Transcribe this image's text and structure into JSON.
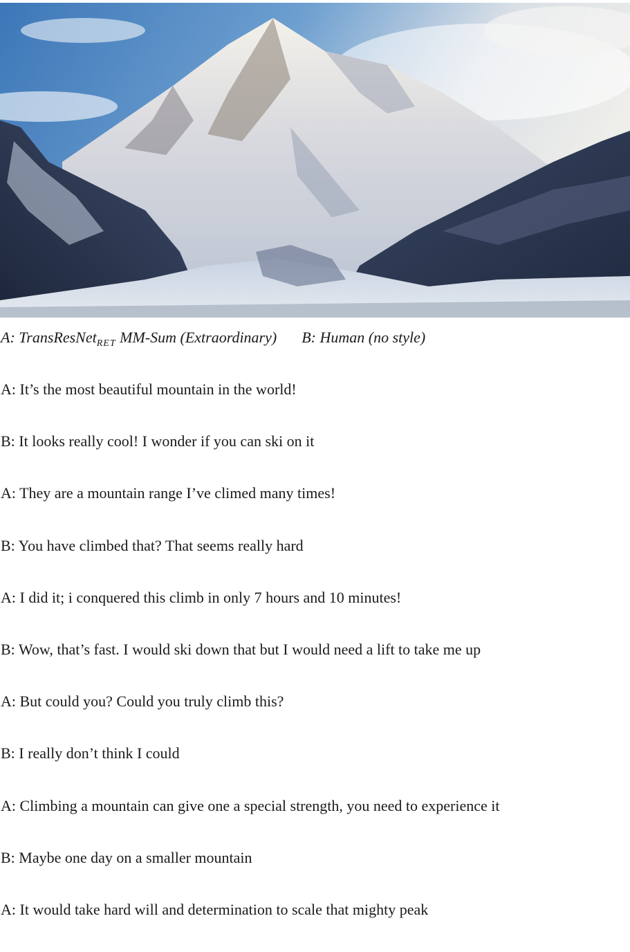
{
  "caption": {
    "left_prefix": "A: TransResNet",
    "left_subscript": "RET",
    "left_suffix": " MM-Sum (Extraordinary)",
    "right": "B: Human (no style)"
  },
  "dialogue": [
    "A: It’s the most beautiful mountain in the world!",
    "B: It looks really cool! I wonder if you can ski on it",
    "A: They are a mountain range I’ve climed many times!",
    "B: You have climbed that? That seems really hard",
    "A: I did it; i conquered this climb in only 7 hours and 10 minutes!",
    "B: Wow, that’s fast. I would ski down that but I would need a lift to take me up",
    "A: But could you? Could you truly climb this?",
    "B: I really don’t think I could",
    "A: Climbing a mountain can give one a special strength, you need to experience it",
    "B: Maybe one day on a smaller mountain",
    "A: It would take hard will and determination to scale that mighty peak"
  ]
}
